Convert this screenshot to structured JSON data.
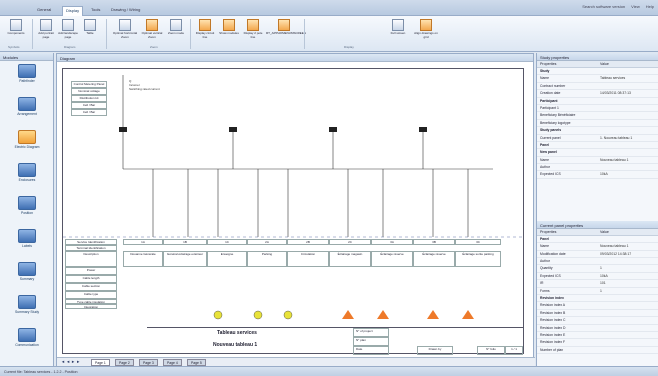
{
  "ribbon": {
    "tabs": [
      "General",
      "Display",
      "Tools",
      "Drawing / Wiring"
    ],
    "active_tab": "Display",
    "window_controls": [
      "Search software version",
      "View",
      "Help"
    ],
    "buttons": [
      {
        "label": "Components",
        "x": 0
      },
      {
        "label": "Add portrait page",
        "x": 0
      },
      {
        "label": "Add landscape page",
        "x": 0
      },
      {
        "label": "Table",
        "x": 0
      },
      {
        "label": "Optimal horizontal Zoom",
        "x": 0
      },
      {
        "label": "Optimal vertical Zoom",
        "x": 0
      },
      {
        "label": "Zoom mode",
        "x": 0
      },
      {
        "label": "Display circuit line",
        "x": 0
      },
      {
        "label": "Show modules",
        "x": 0
      },
      {
        "label": "Display 2 pole line",
        "x": 0
      },
      {
        "label": "RT_APPHOMENUMSCREEN",
        "x": 0
      },
      {
        "label": "Full screen",
        "x": 0
      },
      {
        "label": "Align drawings on grid",
        "x": 0
      }
    ],
    "groups": [
      "Symbols",
      "Diagram",
      "Zoom",
      "Display"
    ]
  },
  "left_panel": {
    "title": "Modules",
    "items": [
      "Pathfinder",
      "Arrangement",
      "Electric Diagram",
      "Enclosures",
      "Position",
      "Labels",
      "Summary",
      "Summary Study",
      "Communication"
    ],
    "active": "Electric Diagram"
  },
  "center": {
    "title": "Diagram",
    "legend_rows": [
      "Control Metering Panel",
      "Nominal voltage",
      "Distribution kit",
      "Cell / Bar",
      "Cell / Bar"
    ],
    "incoming": [
      "Q",
      "Incomer",
      "Switching rated current"
    ],
    "circuit_header": [
      "Service Identification",
      "Terminal Identification",
      "Description",
      "Power",
      "Cable length",
      "Cable section",
      "Cable type",
      "Type cable insulation",
      "Integration"
    ],
    "circuits": [
      {
        "id": "1A",
        "desc": "Douanne Générale"
      },
      {
        "id": "1B",
        "desc": "Général éclairage extérieur"
      },
      {
        "id": "1C",
        "desc": "Enseigne"
      },
      {
        "id": "2A",
        "desc": "Parking"
      },
      {
        "id": "2B",
        "desc": "Circulation"
      },
      {
        "id": "2C",
        "desc": "Éclairage magasin"
      },
      {
        "id": "3A",
        "desc": "Éclairage réserve"
      },
      {
        "id": "3B",
        "desc": "Éclairage réserve"
      },
      {
        "id": "3C",
        "desc": "Éclairage sortie parking"
      }
    ],
    "title_block": {
      "main_title": "Tableau services",
      "subtitle": "Nouveau tableau 1",
      "labels": [
        "N° of project",
        "N° plan",
        "Date",
        "Drawn by",
        "N° folio"
      ],
      "folio": "1 / 1"
    },
    "page_tabs": [
      "Page 1",
      "Page 2",
      "Page 3",
      "Page 4",
      "Page 5"
    ],
    "active_page": "Page 1"
  },
  "study_properties": {
    "title": "Study properties",
    "columns": [
      "Properties",
      "Value"
    ],
    "rows": [
      {
        "k": "Study",
        "v": "",
        "cat": true
      },
      {
        "k": "Name",
        "v": "Tableau services"
      },
      {
        "k": "Contract number",
        "v": ""
      },
      {
        "k": "Creation date",
        "v": "14/03/2011 08:37:13"
      },
      {
        "k": "Participant",
        "v": "",
        "cat": true
      },
      {
        "k": "Participant 1",
        "v": ""
      },
      {
        "k": "Beneficiary Bénéficiaire",
        "v": ""
      },
      {
        "k": "Beneficiary logotype",
        "v": ""
      },
      {
        "k": "Study panels",
        "v": "",
        "cat": true
      },
      {
        "k": "Current panel",
        "v": "1. Nouveau tableau 1"
      },
      {
        "k": "Panel",
        "v": "",
        "cat": true
      },
      {
        "k": "New panel",
        "v": "",
        "cat": true
      },
      {
        "k": "Name",
        "v": "Nouveau tableau 1"
      },
      {
        "k": "Author",
        "v": ""
      },
      {
        "k": "Expected ICS",
        "v": "10kA"
      }
    ]
  },
  "panel_properties": {
    "title": "Current panel properties",
    "columns": [
      "Properties",
      "Value"
    ],
    "rows": [
      {
        "k": "Panel",
        "v": "",
        "cat": true
      },
      {
        "k": "Name",
        "v": "Nouveau tableau 1"
      },
      {
        "k": "Modification date",
        "v": "09/03/2012 14:38:17"
      },
      {
        "k": "Author",
        "v": ""
      },
      {
        "k": "Quantity",
        "v": "1"
      },
      {
        "k": "Expected ICS",
        "v": "10kA"
      },
      {
        "k": "IR",
        "v": "101"
      },
      {
        "k": "Forms",
        "v": "1"
      },
      {
        "k": "Revision index",
        "v": "",
        "cat": true
      },
      {
        "k": "Revision index A",
        "v": ""
      },
      {
        "k": "Revision index B",
        "v": ""
      },
      {
        "k": "Revision index C",
        "v": ""
      },
      {
        "k": "Revision index D",
        "v": ""
      },
      {
        "k": "Revision index E",
        "v": ""
      },
      {
        "k": "Revision index F",
        "v": ""
      },
      {
        "k": "Number of plan",
        "v": ""
      }
    ]
  },
  "status": "Current file: Tableau services - 1.2.2 - Position",
  "colors": {
    "accent": "#f1a23a",
    "brand": "#3f6fb3",
    "frame": "#98acc8"
  }
}
